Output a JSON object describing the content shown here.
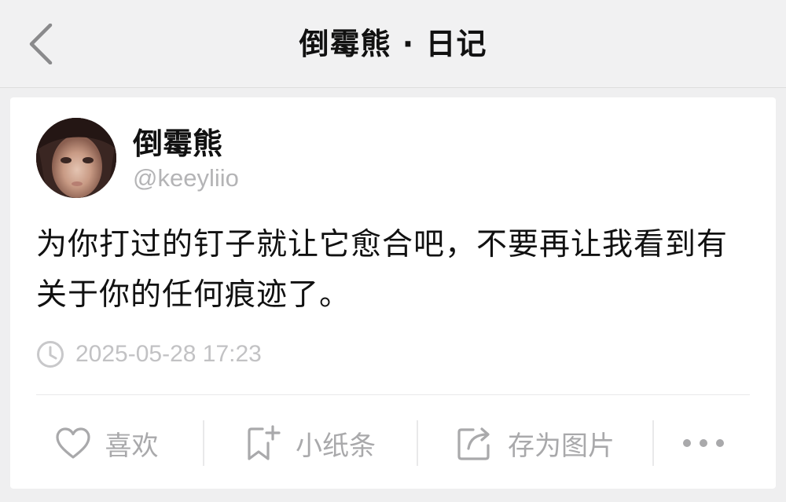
{
  "navbar": {
    "back_icon": "chevron-left-icon",
    "title": "倒霉熊 · 日记"
  },
  "post": {
    "author_name": "倒霉熊",
    "author_handle": "@keeyliio",
    "text": "为你打过的钉子就让它愈合吧，不要再让我看到有关于你的任何痕迹了。",
    "timestamp_icon": "clock-icon",
    "timestamp": "2025-05-28 17:23"
  },
  "actions": {
    "like": {
      "icon": "heart-icon",
      "label": "喜欢"
    },
    "note": {
      "icon": "bookmark-plus-icon",
      "label": "小纸条"
    },
    "save_image": {
      "icon": "share-box-icon",
      "label": "存为图片"
    },
    "more": {
      "icon": "more-dots-icon"
    }
  },
  "colors": {
    "background": "#efeff0",
    "card": "#ffffff",
    "primary_text": "#111111",
    "secondary_text": "#b4b4b6",
    "icon_gray": "#a9a9ab"
  }
}
